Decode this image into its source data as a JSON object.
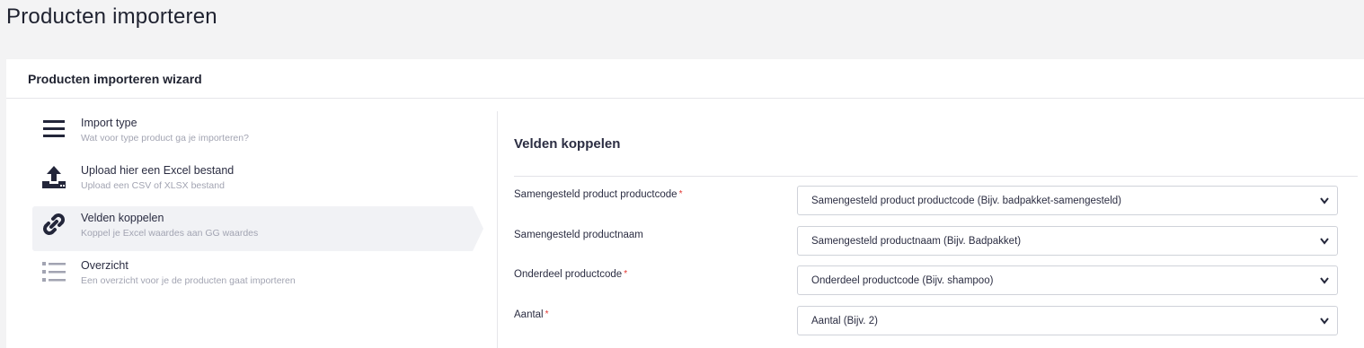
{
  "page": {
    "title": "Producten importeren"
  },
  "card": {
    "title": "Producten importeren wizard"
  },
  "steps": [
    {
      "title": "Import type",
      "subtitle": "Wat voor type product ga je importeren?",
      "icon": "menu-icon"
    },
    {
      "title": "Upload hier een Excel bestand",
      "subtitle": "Upload een CSV of XLSX bestand",
      "icon": "upload-icon"
    },
    {
      "title": "Velden koppelen",
      "subtitle": "Koppel je Excel waardes aan GG waardes",
      "icon": "link-icon",
      "active": true
    },
    {
      "title": "Overzicht",
      "subtitle": "Een overzicht voor je de producten gaat importeren",
      "icon": "list-icon"
    }
  ],
  "main": {
    "title": "Velden koppelen",
    "fields": [
      {
        "label": "Samengesteld product productcode",
        "required": "*",
        "value": "Samengesteld product productcode (Bijv. badpakket-samengesteld)"
      },
      {
        "label": "Samengesteld productnaam",
        "required": "",
        "value": "Samengesteld productnaam (Bijv. Badpakket)"
      },
      {
        "label": "Onderdeel productcode",
        "required": "*",
        "value": "Onderdeel productcode (Bijv. shampoo)"
      },
      {
        "label": "Aantal",
        "required": "*",
        "value": "Aantal (Bijv. 2)"
      }
    ]
  },
  "colors": {
    "accent": "#2b2d42",
    "muted": "#a2a4b2",
    "required": "#e3342f",
    "active_bg": "#f1f2f5"
  }
}
